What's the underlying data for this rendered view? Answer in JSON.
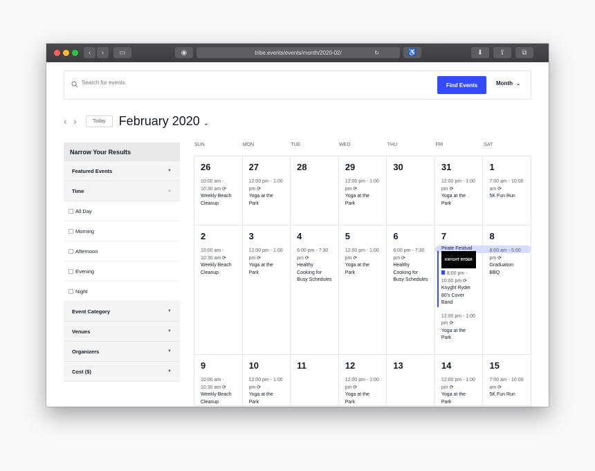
{
  "browser": {
    "url": "tribe.events/events/month/2020-02/"
  },
  "search": {
    "placeholder": "Search for events",
    "find_label": "Find Events",
    "view_label": "Month"
  },
  "nav": {
    "today_label": "Today",
    "month_title": "February 2020"
  },
  "sidebar": {
    "title": "Narrow Your Results",
    "sections": [
      {
        "label": "Featured Events"
      },
      {
        "label": "Time"
      }
    ],
    "time_options": [
      "All Day",
      "Morning",
      "Afternoon",
      "Evening",
      "Night"
    ],
    "more_sections": [
      {
        "label": "Event Category"
      },
      {
        "label": "Venues"
      },
      {
        "label": "Organizers"
      },
      {
        "label": "Cost ($)"
      }
    ]
  },
  "calendar": {
    "weekdays": [
      "SUN",
      "MON",
      "TUE",
      "WED",
      "THU",
      "FRI",
      "SAT"
    ],
    "weeks": [
      {
        "days": [
          {
            "num": "26",
            "events": [
              {
                "time": "10:00 am - 10:30 am",
                "title": "Weekly Beach Cleanup"
              }
            ]
          },
          {
            "num": "27",
            "events": [
              {
                "time": "12:00 pm - 1:00 pm",
                "title": "Yoga at the Park"
              }
            ]
          },
          {
            "num": "28",
            "events": []
          },
          {
            "num": "29",
            "events": [
              {
                "time": "12:00 pm - 1:00 pm",
                "title": "Yoga at the Park"
              }
            ]
          },
          {
            "num": "30",
            "events": []
          },
          {
            "num": "31",
            "events": [
              {
                "time": "12:00 pm - 1:00 pm",
                "title": "Yoga at the Park"
              }
            ]
          },
          {
            "num": "1",
            "events": [
              {
                "time": "7:00 am - 10:00 am",
                "title": "5K Fun Run"
              }
            ]
          }
        ]
      },
      {
        "multiday": "Pirate Festival",
        "days": [
          {
            "num": "2",
            "events": [
              {
                "time": "10:00 am - 10:30 am",
                "title": "Weekly Beach Cleanup"
              }
            ]
          },
          {
            "num": "3",
            "events": [
              {
                "time": "12:00 pm - 1:00 pm",
                "title": "Yoga at the Park"
              }
            ]
          },
          {
            "num": "4",
            "events": [
              {
                "time": "6:00 pm - 7:30 pm",
                "title": "Healthy Cooking for Busy Schedules"
              }
            ]
          },
          {
            "num": "5",
            "events": [
              {
                "time": "12:00 pm - 1:00 pm",
                "title": "Yoga at the Park"
              }
            ]
          },
          {
            "num": "6",
            "events": [
              {
                "time": "6:00 pm - 7:30 pm",
                "title": "Healthy Cooking for Busy Schedules"
              }
            ]
          },
          {
            "num": "7",
            "featured": {
              "image_text": "KNYGHT RYDER",
              "time": "8:00 pm - 10:00 pm",
              "title": "Knyght Ryder 80's Cover Band"
            },
            "events": [
              {
                "time": "12:00 pm - 1:00 pm",
                "title": "Yoga at the Park"
              }
            ]
          },
          {
            "num": "8",
            "events": [
              {
                "time": "8:00 am - 5:00 pm",
                "title": "Graduation BBQ"
              }
            ]
          }
        ]
      },
      {
        "days": [
          {
            "num": "9",
            "events": [
              {
                "time": "10:00 am - 10:30 am",
                "title": "Weekly Beach Cleanup"
              }
            ]
          },
          {
            "num": "10",
            "events": [
              {
                "time": "12:00 pm - 1:00 pm",
                "title": "Yoga at the Park"
              }
            ]
          },
          {
            "num": "11",
            "events": []
          },
          {
            "num": "12",
            "events": [
              {
                "time": "12:00 pm - 1:00 pm",
                "title": "Yoga at the Park"
              }
            ]
          },
          {
            "num": "13",
            "events": []
          },
          {
            "num": "14",
            "events": [
              {
                "time": "12:00 pm - 1:00 pm",
                "title": "Yoga at the Park"
              }
            ]
          },
          {
            "num": "15",
            "events": [
              {
                "time": "7:00 am - 10:00 am",
                "title": "5K Fun Run"
              }
            ]
          }
        ]
      }
    ]
  }
}
